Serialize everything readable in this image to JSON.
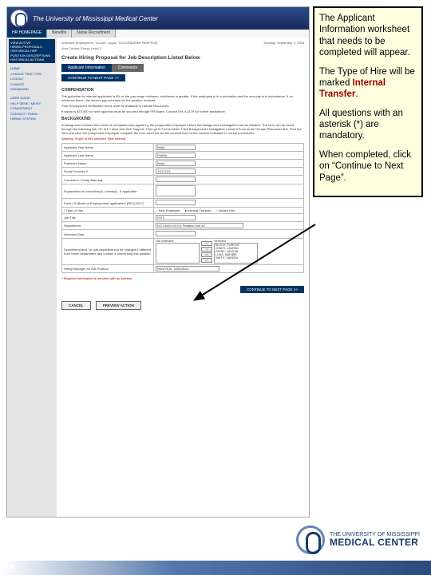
{
  "banner": {
    "title": "The University of Mississippi Medical Center"
  },
  "tabs": {
    "home": "HR HOMEPAGE",
    "benefits": "Benefits",
    "nurse": "Nurse Recruitment"
  },
  "sidebar": {
    "block1": [
      "VIEW ACTIVE",
      "HIRING PROPOSALS",
      "HISTORICAL HRP",
      "POSITION DESCRIPTIONS",
      "HISTORICAL ACTIONS"
    ],
    "links1": [
      "HOME",
      "CHANGE PWD TYPE",
      "LOGOUT",
      "CHANGE",
      "PASSWORD"
    ],
    "links2": [
      "USER GUIDE",
      "HELP DESK / MERIT",
      "COMMITMENT",
      "CONTACT / EMAIL",
      "HIRING SYSTEM"
    ]
  },
  "crumb": {
    "welcome": "Welcome Employment. You are: Logan, Tina DEBORAH RENFROE.",
    "group": "Your Current Group: Level 2",
    "date": "Tuesday, September 2, 2008"
  },
  "page_title": "Create Hiring Proposal for Job Description Listed Below",
  "subtabs": {
    "a": "Applicant Information",
    "b": "Comments"
  },
  "next_btn": "CONTINUE TO NEXT PAGE >>",
  "section1": {
    "head": "COMPENSATION",
    "p1": "The guideline for internal applicants is 8% or the pay range minimum, whichever is greater. If the employee is in a promotion and the new pay is in accordance. If no, reference them - the current pay schedule for the position involved.",
    "p2": "Prior Employment Verification forms must be available in Human Resources.",
    "p3": "If salary is $75,000 or more approval must be secured through HR Board. Contact Ext. 4-1179 for further assistance."
  },
  "section2": {
    "head": "BACKGROUND",
    "p1": "A background consent form must be completed and signed by the prospective employee before the background investigation can be initiated. The form can be found through the following link: Go to L:\\ drive and click Support. Then go to Forms folder. Click Background Investigation Consent Form at the Human Resources link. Print the form and have the prospective employee complete the form and then fax the consent form to the number indicated in current procedures.",
    "p2": "Warning: if type of hire selected 'New Internal'"
  },
  "form": {
    "first_name_lbl": "Applicant First Name",
    "first_name_val": "Betty",
    "last_name_lbl": "Applicant Last Name",
    "last_name_val": "Rubble",
    "pref_name_lbl": "Preferred Name",
    "pref_name_val": "Betty",
    "ssn_lbl": "Social Security #",
    "ssn_val": "111111111",
    "conviction_lbl": "Conviction / Guilty Warning",
    "explain_lbl": "Explanation of conviction(s) / crime(s) - if applicable",
    "i9_lbl": "Does I-9 (Basis of Employment) applicable? (REQ-0017)",
    "type_lbl": "* Type of Hire",
    "type_opts": [
      "New Employee",
      "Internal Transfer",
      "Instant Hire"
    ],
    "job_title_lbl": "Job Title",
    "job_title_val": "RN II",
    "dept_lbl": "Department",
    "dept_val": "DO 13000 ICECO Pediatric Unit 4C",
    "interview_lbl": "Interview Date",
    "search_lbl": "Department and / or sub-department to be charged if different from home department and contact # concerning this position",
    "not_selected": "Not Selected:",
    "selected": "Selected",
    "names": [
      "BLOCH, PORCHE",
      "JONES, LAUREN",
      "PAYNE, CINTHIA",
      "LUNA, MARIBEL",
      "SMITH, SANDRA"
    ],
    "manager_lbl": "Hiring Manager for this Position",
    "manager_val": "RENFROE, DEBORAH"
  },
  "mandatory_note": "* Required information is denoted with an asterisk.",
  "footer": {
    "cancel": "CANCEL",
    "preview": "PREVIEW ACTION"
  },
  "callout": {
    "p1a": "The Applicant Information worksheet that needs to be completed will appear.",
    "p2a": "The Type of Hire will be marked ",
    "p2b": "Internal Transfer",
    "p2c": ".",
    "p3a": "All questions with an asterisk (*) are mandatory.",
    "p4a": "When completed, click on “Continue to Next Page”."
  },
  "footer_logo": {
    "small": "THE UNIVERSITY OF MISSISSIPPI",
    "big": "MEDICAL CENTER"
  },
  "page_number": "19"
}
